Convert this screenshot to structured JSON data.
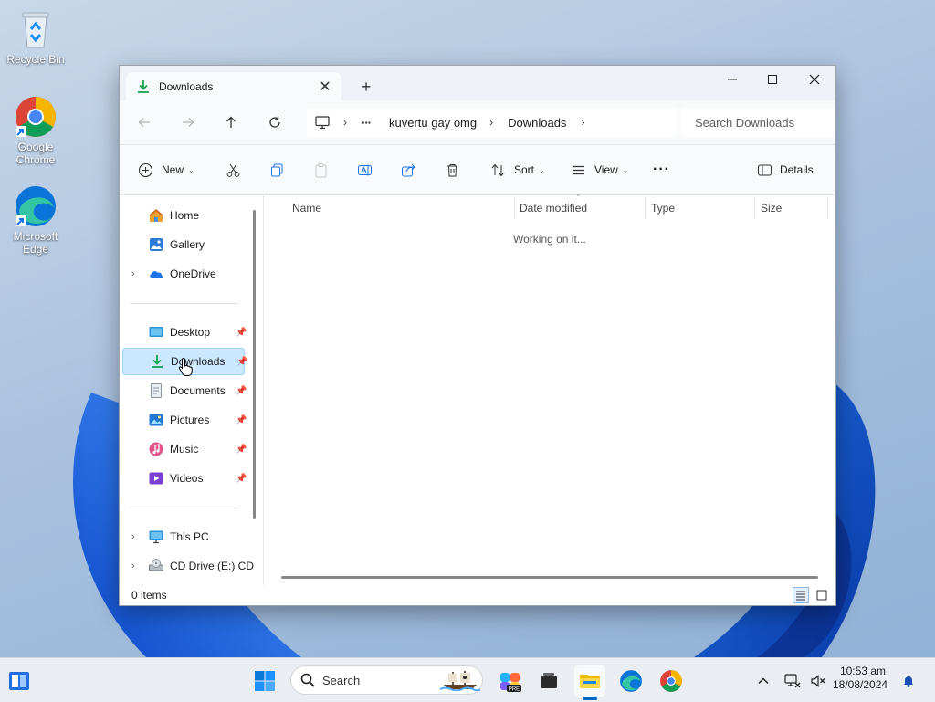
{
  "desktop": {
    "icons": [
      {
        "label": "Recycle Bin",
        "icon": "recycle-bin-icon"
      },
      {
        "label": "Google Chrome",
        "icon": "chrome-icon"
      },
      {
        "label": "Microsoft Edge",
        "icon": "edge-icon"
      }
    ]
  },
  "window": {
    "tab": {
      "label": "Downloads",
      "icon": "download-icon"
    },
    "breadcrumb": {
      "more": "···",
      "items": [
        "kuvertu gay omg",
        "Downloads"
      ]
    },
    "search": {
      "placeholder": "Search Downloads"
    },
    "commands": {
      "new": "New",
      "sort": "Sort",
      "view": "View",
      "more": "···",
      "details": "Details"
    },
    "nav": {
      "top": [
        {
          "label": "Home",
          "icon": "home-icon"
        },
        {
          "label": "Gallery",
          "icon": "gallery-icon"
        },
        {
          "label": "OneDrive",
          "icon": "onedrive-icon"
        }
      ],
      "pinned": [
        {
          "label": "Desktop",
          "icon": "desktop-folder-icon"
        },
        {
          "label": "Downloads",
          "icon": "download-icon",
          "selected": true
        },
        {
          "label": "Documents",
          "icon": "documents-icon"
        },
        {
          "label": "Pictures",
          "icon": "pictures-icon"
        },
        {
          "label": "Music",
          "icon": "music-icon"
        },
        {
          "label": "Videos",
          "icon": "videos-icon"
        }
      ],
      "bottom": [
        {
          "label": "This PC",
          "icon": "this-pc-icon"
        },
        {
          "label": "CD Drive (E:) CD",
          "icon": "cd-drive-icon"
        }
      ]
    },
    "columns": [
      "Name",
      "Date modified",
      "Type",
      "Size"
    ],
    "status_message": "Working on it...",
    "status_bar": "0 items"
  },
  "taskbar": {
    "search_label": "Search",
    "time": "10:53 am",
    "date": "18/08/2024"
  },
  "colors": {
    "accent": "#0067c0",
    "selection": "#cce8ff",
    "download_green": "#16a34a"
  }
}
